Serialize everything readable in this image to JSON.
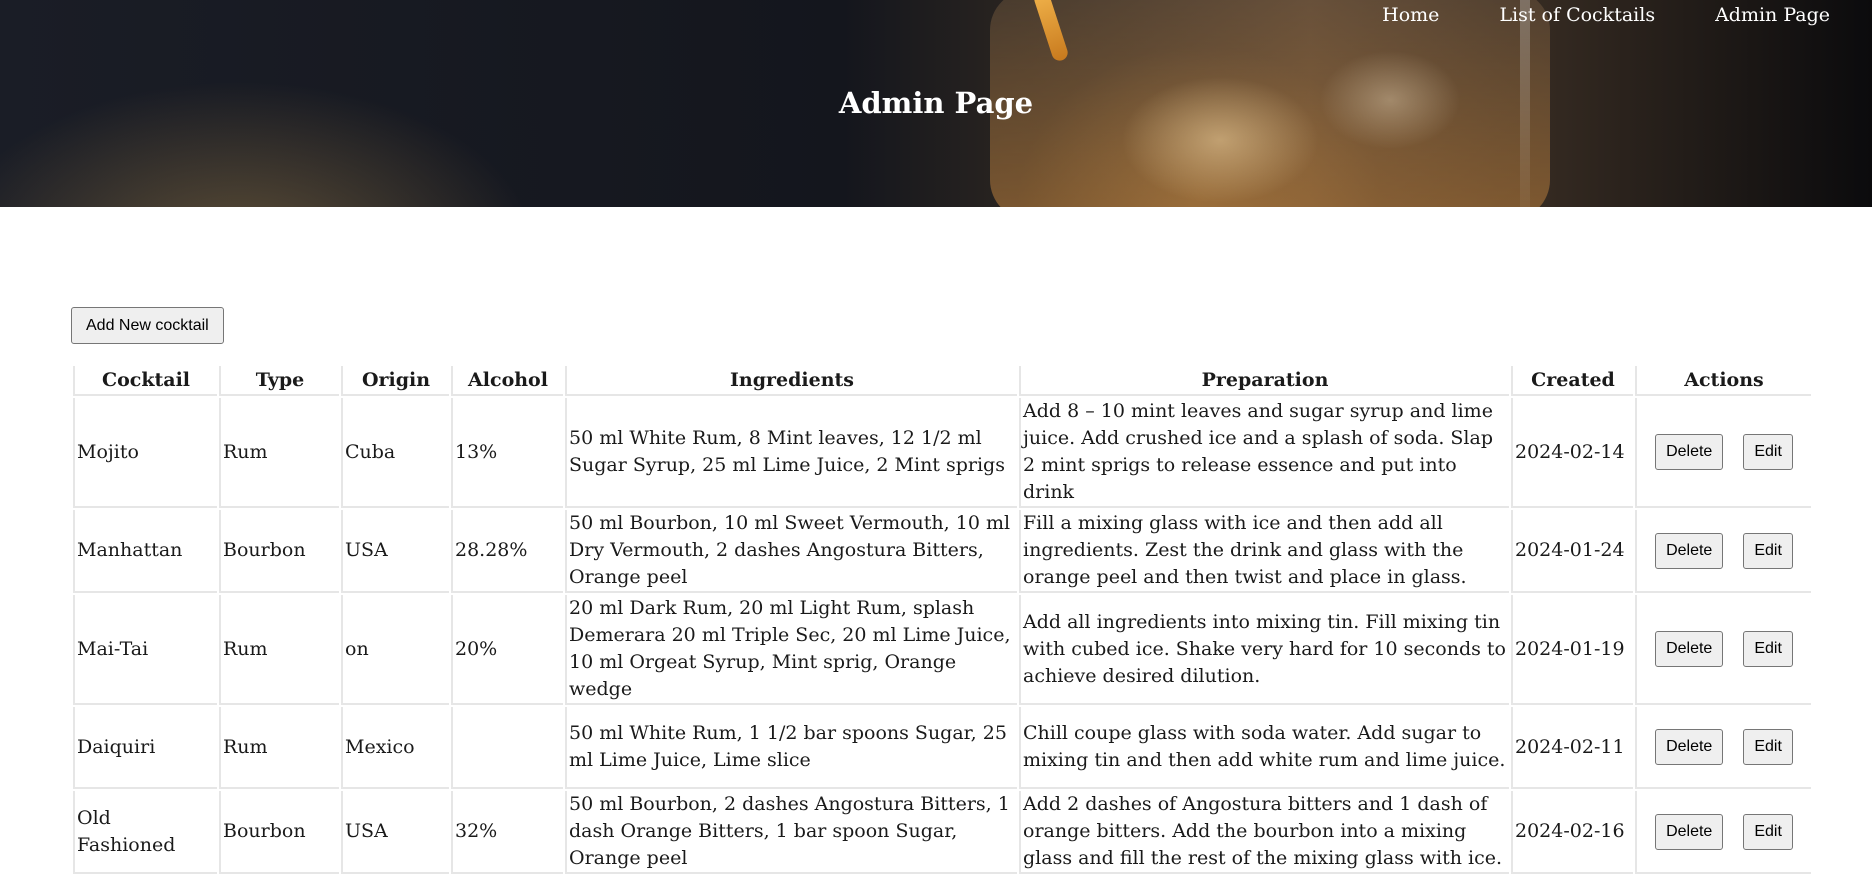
{
  "nav": {
    "items": [
      "Home",
      "List of Cocktails",
      "Admin Page"
    ]
  },
  "header": {
    "title": "Admin Page"
  },
  "toolbar": {
    "add_label": "Add New cocktail"
  },
  "table": {
    "headers": [
      "Cocktail",
      "Type",
      "Origin",
      "Alcohol",
      "Ingredients",
      "Preparation",
      "Created",
      "Actions"
    ],
    "rows": [
      {
        "cocktail": "Mojito",
        "type": "Rum",
        "origin": "Cuba",
        "alcohol": "13%",
        "ingredients": "50 ml White Rum, 8 Mint leaves, 12 1/2 ml Sugar Syrup, 25 ml Lime Juice, 2 Mint sprigs",
        "preparation": "Add 8 – 10 mint leaves and sugar syrup and lime juice. Add crushed ice and a splash of soda. Slap 2 mint sprigs to release essence and put into drink",
        "created": "2024-02-14",
        "delete_label": "Delete",
        "edit_label": "Edit"
      },
      {
        "cocktail": "Manhattan",
        "type": "Bourbon",
        "origin": "USA",
        "alcohol": "28.28%",
        "ingredients": "50 ml Bourbon, 10 ml Sweet Vermouth, 10 ml Dry Vermouth, 2 dashes Angostura Bitters, Orange peel",
        "preparation": "Fill a mixing glass with ice and then add all ingredients. Zest the drink and glass with the orange peel and then twist and place in glass.",
        "created": "2024-01-24",
        "delete_label": "Delete",
        "edit_label": "Edit"
      },
      {
        "cocktail": "Mai-Tai",
        "type": "Rum",
        "origin": "on",
        "alcohol": "20%",
        "ingredients": "20 ml Dark Rum, 20 ml Light Rum, splash Demerara 20 ml Triple Sec, 20 ml Lime Juice, 10 ml Orgeat Syrup, Mint sprig, Orange wedge",
        "preparation": "Add all ingredients into mixing tin. Fill mixing tin with cubed ice. Shake very hard for 10 seconds to achieve desired dilution.",
        "created": "2024-01-19",
        "delete_label": "Delete",
        "edit_label": "Edit"
      },
      {
        "cocktail": "Daiquiri",
        "type": "Rum",
        "origin": "Mexico",
        "alcohol": "",
        "ingredients": "50 ml White Rum, 1 1/2 bar spoons Sugar, 25 ml Lime Juice, Lime slice",
        "preparation": "Chill coupe glass with soda water. Add sugar to mixing tin and then add white rum and lime juice.",
        "created": "2024-02-11",
        "delete_label": "Delete",
        "edit_label": "Edit"
      },
      {
        "cocktail": "Old Fashioned",
        "type": "Bourbon",
        "origin": "USA",
        "alcohol": "32%",
        "ingredients": "50 ml Bourbon, 2 dashes Angostura Bitters, 1 dash Orange Bitters, 1 bar spoon Sugar, Orange peel",
        "preparation": "Add 2 dashes of Angostura bitters and 1 dash of orange bitters. Add the bourbon into a mixing glass and fill the rest of the mixing glass with ice.",
        "created": "2024-02-16",
        "delete_label": "Delete",
        "edit_label": "Edit"
      }
    ]
  }
}
